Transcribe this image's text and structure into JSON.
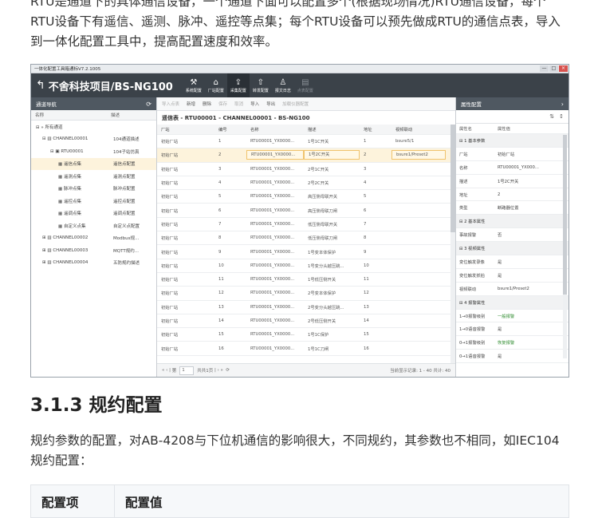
{
  "intro_text": "RTU是通道下的具体通信设备，一个通道下面可以配置多个(根据现场情况)RTU通信设备，每个RTU设备下有遥信、遥测、脉冲、遥控等点集；每个RTU设备可以预先做成RTU的通信点表，导入到一体化配置工具中，提高配置速度和效率。",
  "screenshot": {
    "window_title": "一体化配置工具箱通标V7.2.1005",
    "window_buttons": [
      "—",
      "□",
      "×"
    ],
    "project_title": "不舍科技项目/BS-NG100",
    "nav": [
      {
        "icon": "wrench-icon",
        "glyph": "⚒",
        "label": "系统配置"
      },
      {
        "icon": "home-icon",
        "glyph": "⌂",
        "label": "厂站配置"
      },
      {
        "icon": "upload-icon",
        "glyph": "⇪",
        "label": "采集配置"
      },
      {
        "icon": "forward-icon",
        "glyph": "⇧",
        "label": "转发配置"
      },
      {
        "icon": "person-icon",
        "glyph": "♙",
        "label": "报文日志"
      },
      {
        "icon": "doc-icon",
        "glyph": "▤",
        "label": "点表配置"
      }
    ],
    "left_panel": {
      "title": "通道导航",
      "columns": [
        "名称",
        "描述"
      ],
      "tree": [
        {
          "name": "» 所有通道",
          "desc": ""
        },
        {
          "name": "CHANNEL00001",
          "desc": "104通道描述"
        },
        {
          "name": "RTU00001",
          "desc": "104子站仿真"
        },
        {
          "name": "遥信点集",
          "desc": "遥信点配置"
        },
        {
          "name": "遥测点集",
          "desc": "遥测点配置"
        },
        {
          "name": "脉冲点集",
          "desc": "脉冲点配置"
        },
        {
          "name": "遥控点集",
          "desc": "遥控点配置"
        },
        {
          "name": "遥调点集",
          "desc": "遥调点配置"
        },
        {
          "name": "自定义点集",
          "desc": "自定义点配置"
        },
        {
          "name": "CHANNEL00002",
          "desc": "Modbus规..."
        },
        {
          "name": "CHANNEL00003",
          "desc": "MQTT规约..."
        },
        {
          "name": "CHANNEL00004",
          "desc": "五防规约描述"
        }
      ]
    },
    "toolbar": [
      "导入点表",
      "新增",
      "删除",
      "保存",
      "取消",
      "导入",
      "导出",
      "加载仪器配置"
    ],
    "table_title": "遥信表 - RTU00001 - CHANNEL00001 - BS-NG100",
    "columns": [
      "厂站",
      "编号",
      "名称",
      "描述",
      "地址",
      "视频联动"
    ],
    "rows": [
      [
        "初始厂站",
        "1",
        "RTU00001_YX0000...",
        "1号1C开关",
        "1",
        "bsure5/1"
      ],
      [
        "初始厂站",
        "2",
        "RTU00001_YX0000...",
        "1号2C开关",
        "2",
        "bsure1/Preset2"
      ],
      [
        "初始厂站",
        "3",
        "RTU00001_YX0000...",
        "2号1C开关",
        "3",
        ""
      ],
      [
        "初始厂站",
        "4",
        "RTU00001_YX0000...",
        "2号2C开关",
        "4",
        ""
      ],
      [
        "初始厂站",
        "5",
        "RTU00001_YX0000...",
        "高压侧母联开关",
        "5",
        ""
      ],
      [
        "初始厂站",
        "6",
        "RTU00001_YX0000...",
        "高压侧母联刀闸",
        "6",
        ""
      ],
      [
        "初始厂站",
        "7",
        "RTU00001_YX0000...",
        "低压侧母联开关",
        "7",
        ""
      ],
      [
        "初始厂站",
        "8",
        "RTU00001_YX0000...",
        "低压侧母联刀闸",
        "8",
        ""
      ],
      [
        "初始厂站",
        "9",
        "RTU00001_YX0000...",
        "1号变本体保护",
        "9",
        ""
      ],
      [
        "初始厂站",
        "10",
        "RTU00001_YX0000...",
        "1号变分头越压跳...",
        "10",
        ""
      ],
      [
        "初始厂站",
        "11",
        "RTU00001_YX0000...",
        "1号低压侧开关",
        "11",
        ""
      ],
      [
        "初始厂站",
        "12",
        "RTU00001_YX0000...",
        "2号变本体保护",
        "12",
        ""
      ],
      [
        "初始厂站",
        "13",
        "RTU00001_YX0000...",
        "2号变分头越压跳...",
        "13",
        ""
      ],
      [
        "初始厂站",
        "14",
        "RTU00001_YX0000...",
        "2号低压侧开关",
        "14",
        ""
      ],
      [
        "初始厂站",
        "15",
        "RTU00001_YX0000...",
        "1号1C保护",
        "15",
        ""
      ],
      [
        "初始厂站",
        "16",
        "RTU00001_YX0000...",
        "1号1C刀闸",
        "16",
        ""
      ]
    ],
    "pager": {
      "page_label": "第",
      "page_value": "1",
      "total": "共共1页",
      "info": "当前显示记录: 1 - 40 共计: 40"
    },
    "property_panel": {
      "title": "属性配置",
      "columns": [
        "属性名",
        "属性值"
      ],
      "rows": [
        {
          "k": "1 基本参数",
          "v": "",
          "group": true
        },
        {
          "k": "厂站",
          "v": "初始厂站"
        },
        {
          "k": "名称",
          "v": "RTU00001_YX000..."
        },
        {
          "k": "描述",
          "v": "1号2C开关"
        },
        {
          "k": "地址",
          "v": "2"
        },
        {
          "k": "类型",
          "v": "断路器位置"
        },
        {
          "k": "2 基本属性",
          "v": "",
          "group": true
        },
        {
          "k": "事故报警",
          "v": "否"
        },
        {
          "k": "3 视频属性",
          "v": "",
          "group": true
        },
        {
          "k": "变位触发录像",
          "v": "是"
        },
        {
          "k": "变位触发抓拍",
          "v": "是"
        },
        {
          "k": "视频联动",
          "v": "bsure1/Preset2"
        },
        {
          "k": "4 报警属性",
          "v": "",
          "group": true
        },
        {
          "k": "1→0报警级别",
          "v": "一般报警",
          "green": true
        },
        {
          "k": "1→0语音报警",
          "v": "是"
        },
        {
          "k": "0→1报警级别",
          "v": "恢复报警",
          "green": true
        },
        {
          "k": "0→1语音报警",
          "v": "是"
        }
      ]
    }
  },
  "section_heading": "3.1.3 规约配置",
  "section_text": "规约参数的配置，对AB-4208与下位机通信的影响很大，不同规约，其参数也不相同，如IEC104规约配置：",
  "config_table": {
    "col1": "配置项",
    "col2": "配置值"
  }
}
